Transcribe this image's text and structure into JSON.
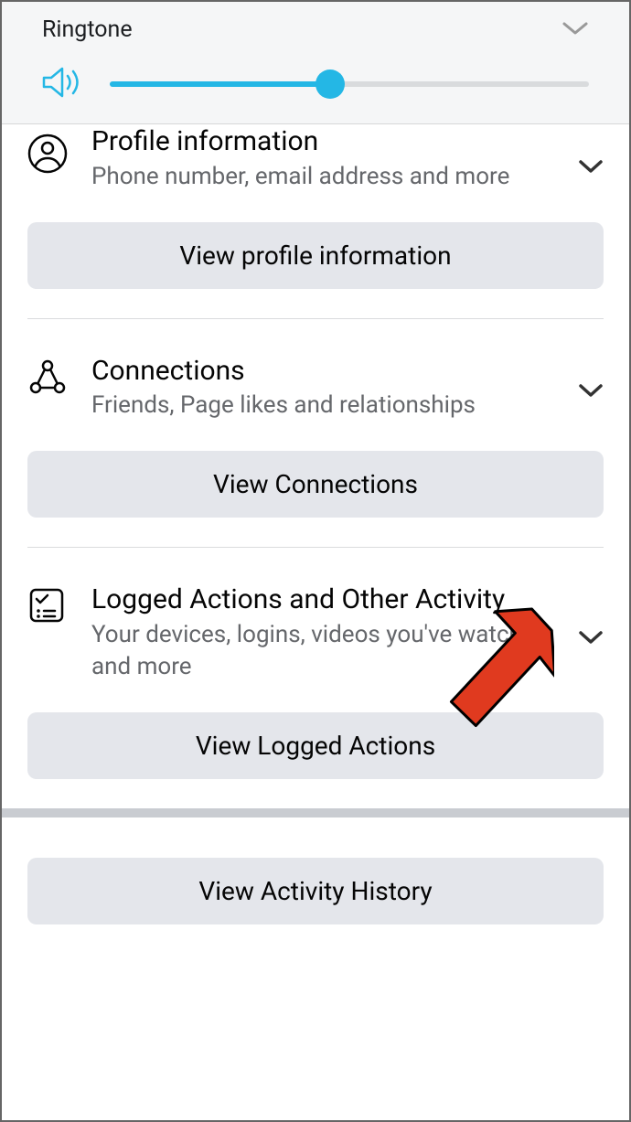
{
  "ringtone": {
    "label": "Ringtone",
    "volume_percent": 46
  },
  "sections": {
    "profile": {
      "title": "Profile information",
      "subtitle": "Phone number, email address and more",
      "button": "View profile information"
    },
    "connections": {
      "title": "Connections",
      "subtitle": "Friends, Page likes and relationships",
      "button": "View Connections"
    },
    "logged": {
      "title": "Logged Actions and Other Activity",
      "subtitle": "Your devices, logins, videos you've watched, and more",
      "button": "View Logged Actions"
    },
    "history": {
      "button": "View Activity History"
    }
  }
}
